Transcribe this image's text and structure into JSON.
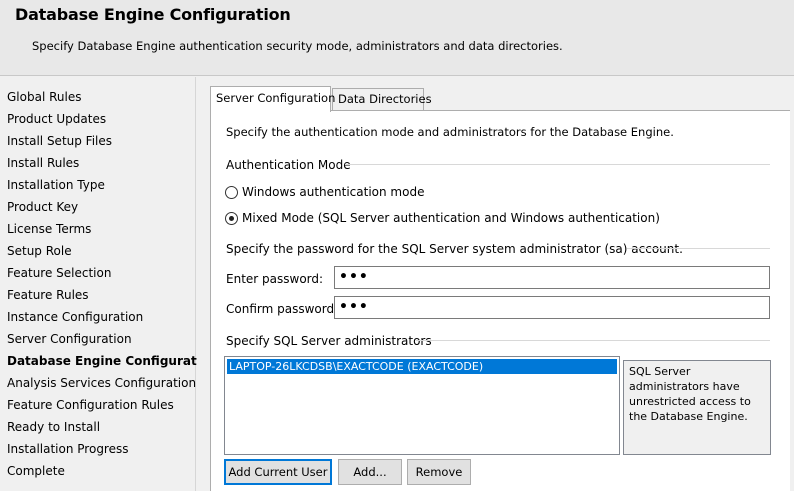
{
  "header": {
    "title": "Database Engine Configuration",
    "subtitle": "Specify Database Engine authentication security mode, administrators and data directories."
  },
  "sidebar": {
    "items": [
      {
        "label": "Global Rules"
      },
      {
        "label": "Product Updates"
      },
      {
        "label": "Install Setup Files"
      },
      {
        "label": "Install Rules"
      },
      {
        "label": "Installation Type"
      },
      {
        "label": "Product Key"
      },
      {
        "label": "License Terms"
      },
      {
        "label": "Setup Role"
      },
      {
        "label": "Feature Selection"
      },
      {
        "label": "Feature Rules"
      },
      {
        "label": "Instance Configuration"
      },
      {
        "label": "Server Configuration"
      },
      {
        "label": "Database Engine Configuration",
        "active": true
      },
      {
        "label": "Analysis Services Configuration"
      },
      {
        "label": "Feature Configuration Rules"
      },
      {
        "label": "Ready to Install"
      },
      {
        "label": "Installation Progress"
      },
      {
        "label": "Complete"
      }
    ]
  },
  "tabs": [
    {
      "label": "Server Configuration",
      "active": true
    },
    {
      "label": "Data Directories",
      "active": false
    }
  ],
  "server_config": {
    "intro": "Specify the authentication mode and administrators for the Database Engine.",
    "auth_mode_label": "Authentication Mode",
    "auth_options": [
      {
        "label": "Windows authentication mode",
        "checked": false
      },
      {
        "label": "Mixed Mode (SQL Server authentication and Windows authentication)",
        "checked": true
      }
    ],
    "password_section_label": "Specify the password for the SQL Server system administrator (sa) account.",
    "enter_password_label": "Enter password:",
    "enter_password_value": "•••",
    "confirm_password_label": "Confirm password:",
    "confirm_password_value": "•••",
    "admins_label": "Specify SQL Server administrators",
    "admins": [
      "LAPTOP-26LKCDSB\\EXACTCODE (EXACTCODE)"
    ],
    "admins_info": "SQL Server administrators have unrestricted access to the Database Engine.",
    "buttons": {
      "add_current_user": "Add Current User",
      "add": "Add...",
      "remove": "Remove"
    }
  },
  "colors": {
    "selection": "#0078d7",
    "header_bg": "#e8e8e8",
    "panel_bg": "#ffffff"
  }
}
